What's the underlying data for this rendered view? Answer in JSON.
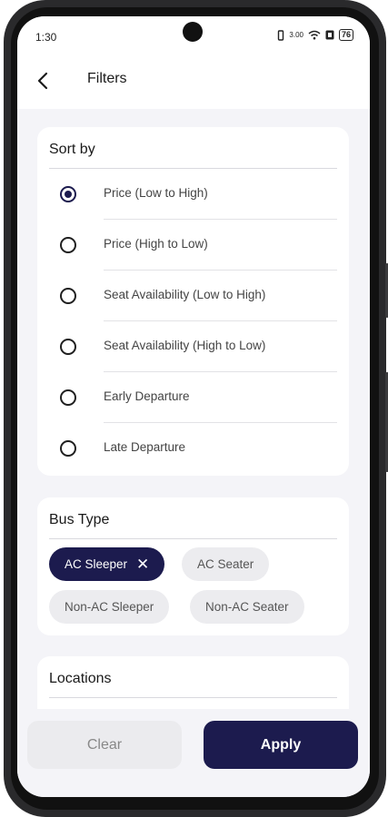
{
  "status_bar": {
    "time": "1:30",
    "data_speed": "3.00",
    "battery": "76"
  },
  "header": {
    "title": "Filters",
    "back_icon": "chevron-left-icon"
  },
  "sort_by": {
    "title": "Sort by",
    "options": [
      {
        "label": "Price (Low to High)",
        "selected": true
      },
      {
        "label": "Price (High to Low)",
        "selected": false
      },
      {
        "label": "Seat Availability (Low to High)",
        "selected": false
      },
      {
        "label": "Seat Availability (High to Low)",
        "selected": false
      },
      {
        "label": "Early Departure",
        "selected": false
      },
      {
        "label": "Late Departure",
        "selected": false
      }
    ]
  },
  "bus_type": {
    "title": "Bus Type",
    "chips": [
      {
        "label": "AC Sleeper",
        "selected": true
      },
      {
        "label": "AC Seater",
        "selected": false
      },
      {
        "label": "Non-AC Sleeper",
        "selected": false
      },
      {
        "label": "Non-AC Seater",
        "selected": false
      }
    ],
    "remove_glyph": "✕"
  },
  "locations": {
    "title": "Locations"
  },
  "actions": {
    "clear_label": "Clear",
    "apply_label": "Apply"
  },
  "colors": {
    "accent": "#1c1b4e",
    "background": "#f4f4f8",
    "card": "#ffffff"
  }
}
